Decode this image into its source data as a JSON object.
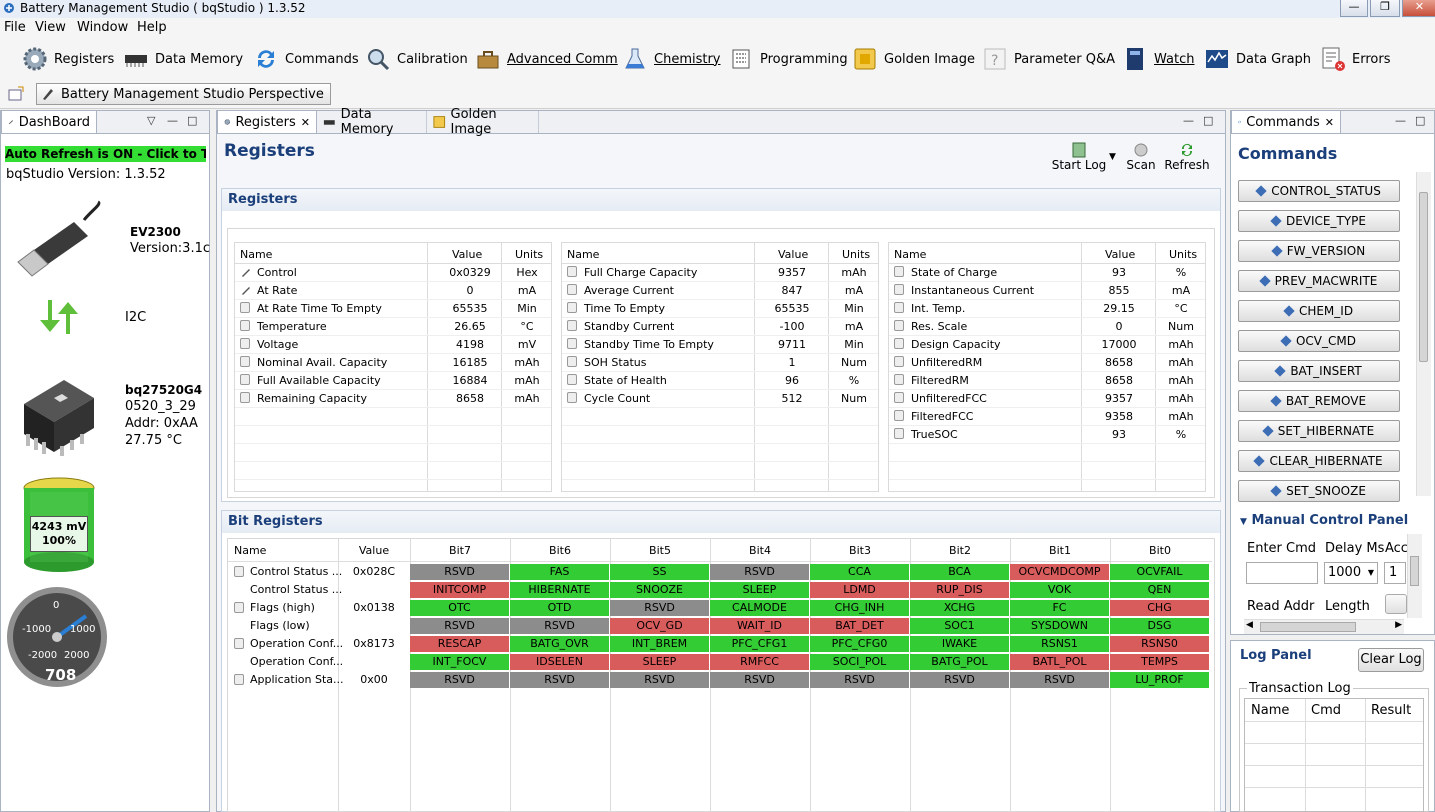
{
  "window": {
    "title": "Battery Management Studio ( bqStudio ) 1.3.52"
  },
  "menu": [
    "File",
    "View",
    "Window",
    "Help"
  ],
  "toolbar": [
    "Registers",
    "Data Memory",
    "Commands",
    "Calibration",
    "Advanced Comm",
    "Chemistry",
    "Programming",
    "Golden Image",
    "Parameter Q&A",
    "Watch",
    "Data Graph",
    "Errors"
  ],
  "perspective": {
    "label": "Battery Management Studio Perspective"
  },
  "dashboard": {
    "tab": "DashBoard",
    "auto_refresh": "Auto Refresh is ON - Click to Turn O",
    "version": "bqStudio Version:  1.3.52",
    "adapter_name": "EV2300",
    "adapter_version": "Version:3.1c",
    "protocol": "I2C",
    "device_name": "bq27520G4",
    "device_fw": "0520_3_29",
    "device_addr": "Addr: 0xAA",
    "device_temp": "27.75 °C",
    "battery_mv": "4243 mV",
    "battery_pct": "100%",
    "battery_level": 1.0,
    "gauge_ticks": [
      "0",
      "-1000",
      "1000",
      "-2000",
      "2000"
    ],
    "gauge_value": "708"
  },
  "editor_tabs": [
    "Registers",
    "Data Memory",
    "Golden Image"
  ],
  "registers_page": {
    "title": "Registers",
    "start_log": "Start Log",
    "scan": "Scan",
    "refresh": "Refresh",
    "section": "Registers",
    "col_name": "Name",
    "col_value": "Value",
    "col_units": "Units",
    "table1": [
      {
        "name": "Control",
        "value": "0x0329",
        "units": "Hex"
      },
      {
        "name": "At Rate",
        "value": "0",
        "units": "mA"
      },
      {
        "name": "At Rate Time To Empty",
        "value": "65535",
        "units": "Min"
      },
      {
        "name": "Temperature",
        "value": "26.65",
        "units": "°C"
      },
      {
        "name": "Voltage",
        "value": "4198",
        "units": "mV"
      },
      {
        "name": "Nominal Avail. Capacity",
        "value": "16185",
        "units": "mAh"
      },
      {
        "name": "Full Available Capacity",
        "value": "16884",
        "units": "mAh"
      },
      {
        "name": "Remaining Capacity",
        "value": "8658",
        "units": "mAh"
      }
    ],
    "table2": [
      {
        "name": "Full Charge Capacity",
        "value": "9357",
        "units": "mAh"
      },
      {
        "name": "Average Current",
        "value": "847",
        "units": "mA"
      },
      {
        "name": "Time To Empty",
        "value": "65535",
        "units": "Min"
      },
      {
        "name": "Standby Current",
        "value": "-100",
        "units": "mA"
      },
      {
        "name": "Standby Time To Empty",
        "value": "9711",
        "units": "Min"
      },
      {
        "name": "SOH Status",
        "value": "1",
        "units": "Num"
      },
      {
        "name": "State of Health",
        "value": "96",
        "units": "%"
      },
      {
        "name": "Cycle Count",
        "value": "512",
        "units": "Num"
      }
    ],
    "table3": [
      {
        "name": "State of Charge",
        "value": "93",
        "units": "%"
      },
      {
        "name": "Instantaneous Current",
        "value": "855",
        "units": "mA"
      },
      {
        "name": "Int. Temp.",
        "value": "29.15",
        "units": "°C"
      },
      {
        "name": "Res. Scale",
        "value": "0",
        "units": "Num"
      },
      {
        "name": "Design Capacity",
        "value": "17000",
        "units": "mAh"
      },
      {
        "name": "UnfilteredRM",
        "value": "8658",
        "units": "mAh"
      },
      {
        "name": "FilteredRM",
        "value": "8658",
        "units": "mAh"
      },
      {
        "name": "UnfilteredFCC",
        "value": "9357",
        "units": "mAh"
      },
      {
        "name": "FilteredFCC",
        "value": "9358",
        "units": "mAh"
      },
      {
        "name": "TrueSOC",
        "value": "93",
        "units": "%"
      }
    ]
  },
  "bit_registers": {
    "section": "Bit Registers",
    "headers": [
      "Name",
      "Value",
      "Bit7",
      "Bit6",
      "Bit5",
      "Bit4",
      "Bit3",
      "Bit2",
      "Bit1",
      "Bit0"
    ],
    "colors": {
      "g": "#34cc34",
      "r": "#d95c5c",
      "x": "#8c8c8c"
    },
    "rows": [
      {
        "name": "Control Status ...",
        "value": "0x028C",
        "lock": true,
        "bits": [
          [
            "RSVD",
            "x"
          ],
          [
            "FAS",
            "g"
          ],
          [
            "SS",
            "g"
          ],
          [
            "RSVD",
            "x"
          ],
          [
            "CCA",
            "g"
          ],
          [
            "BCA",
            "g"
          ],
          [
            "OCVCMDCOMP",
            "r"
          ],
          [
            "OCVFAIL",
            "g"
          ]
        ]
      },
      {
        "name": "Control Status ...",
        "value": "",
        "lock": false,
        "bits": [
          [
            "INITCOMP",
            "r"
          ],
          [
            "HIBERNATE",
            "g"
          ],
          [
            "SNOOZE",
            "g"
          ],
          [
            "SLEEP",
            "g"
          ],
          [
            "LDMD",
            "r"
          ],
          [
            "RUP_DIS",
            "r"
          ],
          [
            "VOK",
            "g"
          ],
          [
            "QEN",
            "g"
          ]
        ]
      },
      {
        "name": "Flags (high)",
        "value": "0x0138",
        "lock": true,
        "bits": [
          [
            "OTC",
            "g"
          ],
          [
            "OTD",
            "g"
          ],
          [
            "RSVD",
            "x"
          ],
          [
            "CALMODE",
            "g"
          ],
          [
            "CHG_INH",
            "g"
          ],
          [
            "XCHG",
            "g"
          ],
          [
            "FC",
            "g"
          ],
          [
            "CHG",
            "r"
          ]
        ]
      },
      {
        "name": "Flags (low)",
        "value": "",
        "lock": false,
        "bits": [
          [
            "RSVD",
            "x"
          ],
          [
            "RSVD",
            "x"
          ],
          [
            "OCV_GD",
            "r"
          ],
          [
            "WAIT_ID",
            "r"
          ],
          [
            "BAT_DET",
            "r"
          ],
          [
            "SOC1",
            "g"
          ],
          [
            "SYSDOWN",
            "g"
          ],
          [
            "DSG",
            "g"
          ]
        ]
      },
      {
        "name": "Operation Conf...",
        "value": "0x8173",
        "lock": true,
        "bits": [
          [
            "RESCAP",
            "r"
          ],
          [
            "BATG_OVR",
            "g"
          ],
          [
            "INT_BREM",
            "g"
          ],
          [
            "PFC_CFG1",
            "g"
          ],
          [
            "PFC_CFG0",
            "g"
          ],
          [
            "IWAKE",
            "g"
          ],
          [
            "RSNS1",
            "g"
          ],
          [
            "RSNS0",
            "r"
          ]
        ]
      },
      {
        "name": "Operation Conf...",
        "value": "",
        "lock": false,
        "bits": [
          [
            "INT_FOCV",
            "g"
          ],
          [
            "IDSELEN",
            "r"
          ],
          [
            "SLEEP",
            "r"
          ],
          [
            "RMFCC",
            "r"
          ],
          [
            "SOCI_POL",
            "g"
          ],
          [
            "BATG_POL",
            "g"
          ],
          [
            "BATL_POL",
            "r"
          ],
          [
            "TEMPS",
            "r"
          ]
        ]
      },
      {
        "name": "Application Sta...",
        "value": "0x00",
        "lock": true,
        "bits": [
          [
            "RSVD",
            "x"
          ],
          [
            "RSVD",
            "x"
          ],
          [
            "RSVD",
            "x"
          ],
          [
            "RSVD",
            "x"
          ],
          [
            "RSVD",
            "x"
          ],
          [
            "RSVD",
            "x"
          ],
          [
            "RSVD",
            "x"
          ],
          [
            "LU_PROF",
            "g"
          ]
        ]
      }
    ]
  },
  "commands_panel": {
    "tab": "Commands",
    "title": "Commands",
    "buttons": [
      "CONTROL_STATUS",
      "DEVICE_TYPE",
      "FW_VERSION",
      "PREV_MACWRITE",
      "CHEM_ID",
      "OCV_CMD",
      "BAT_INSERT",
      "BAT_REMOVE",
      "SET_HIBERNATE",
      "CLEAR_HIBERNATE",
      "SET_SNOOZE"
    ],
    "manual_title": "Manual Control Panel",
    "enter_cmd": "Enter Cmd",
    "delay_ms": "Delay Ms",
    "acc": "Acc",
    "delay_value": "1000",
    "acc_value": "1",
    "read_addr": "Read Addr",
    "length": "Length",
    "log_title": "Log Panel",
    "clear_log": "Clear Log",
    "transaction_log": "Transaction Log",
    "log_cols": [
      "Name",
      "Cmd",
      "Result"
    ]
  }
}
